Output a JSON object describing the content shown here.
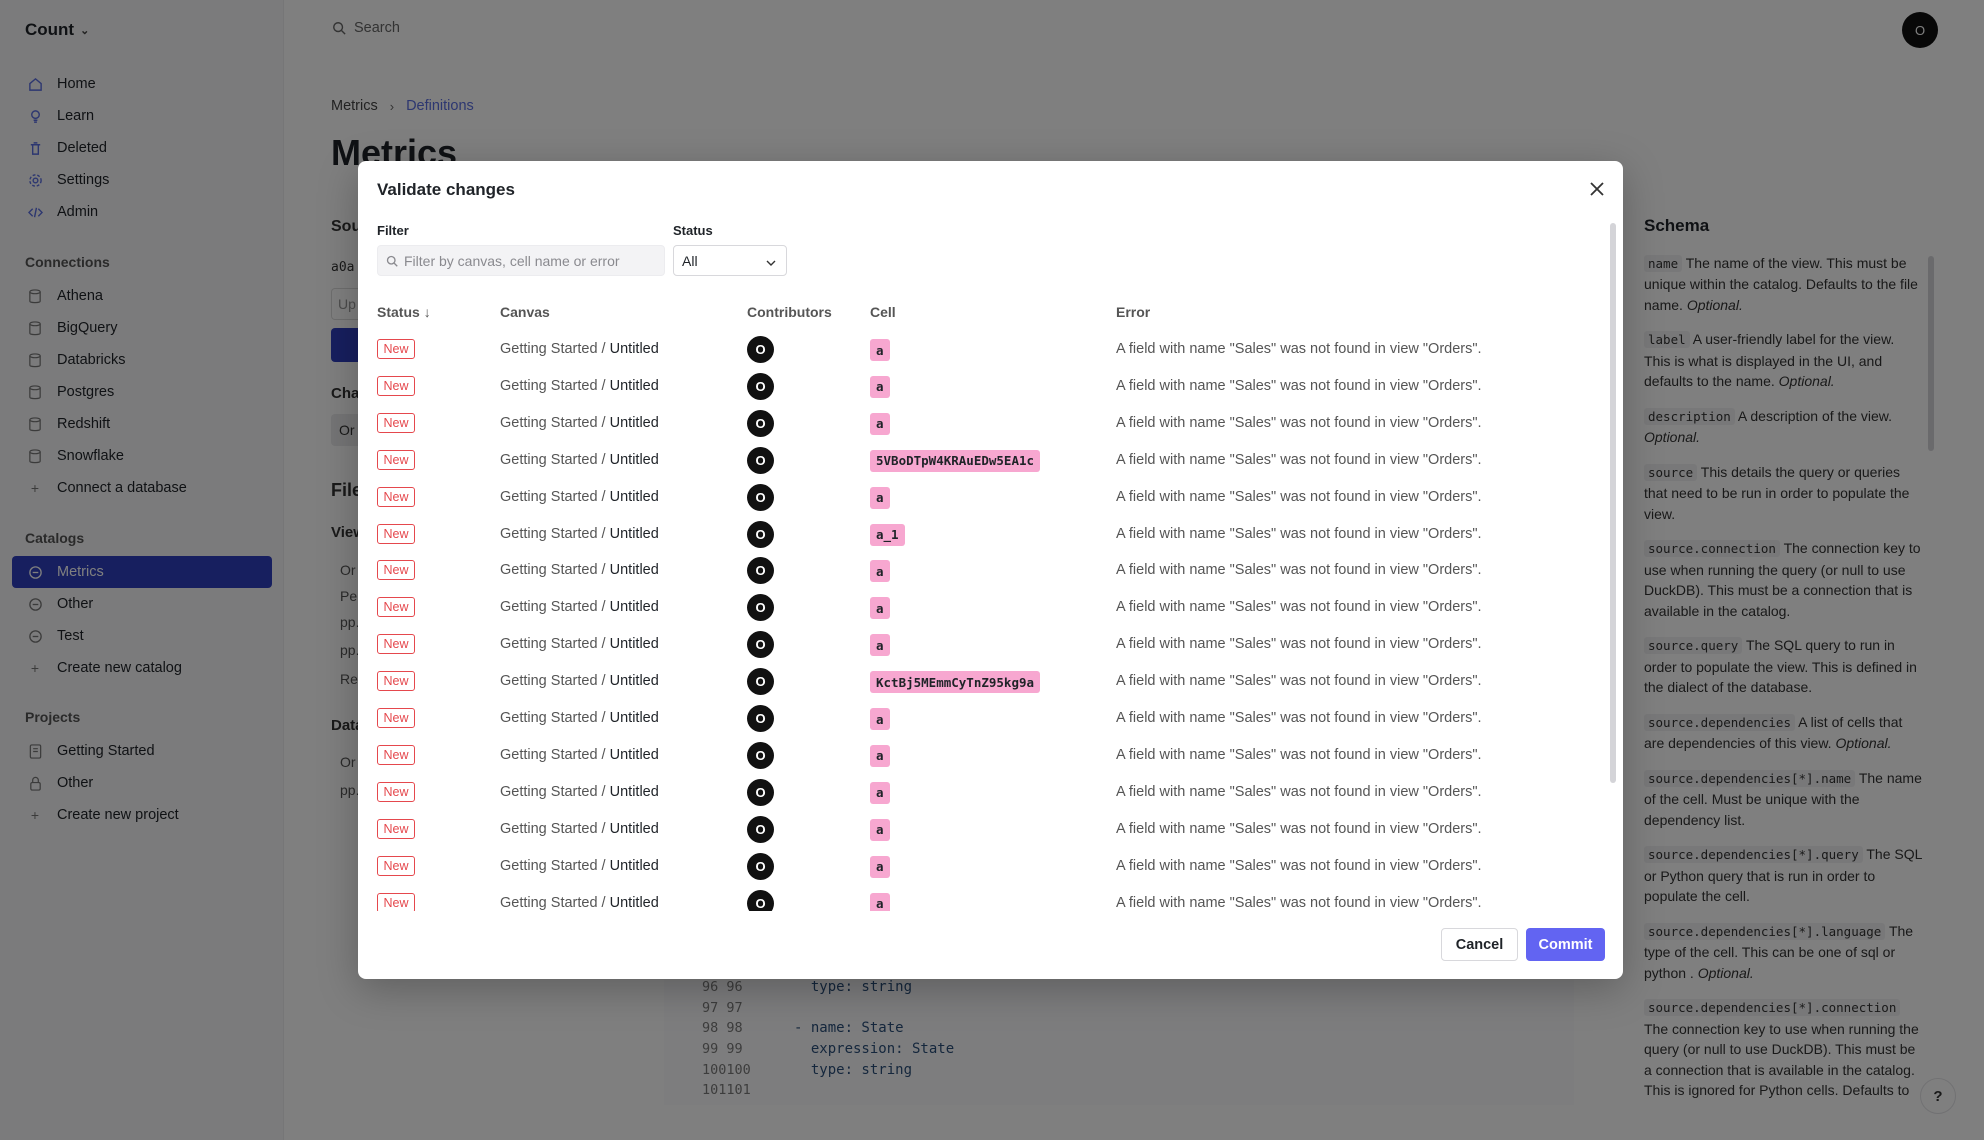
{
  "app": {
    "name": "Count"
  },
  "topbar": {
    "search_placeholder": "Search",
    "avatar_initial": "O"
  },
  "sidebar": {
    "nav": [
      {
        "label": "Home",
        "icon": "home-icon"
      },
      {
        "label": "Learn",
        "icon": "lightbulb-icon"
      },
      {
        "label": "Deleted",
        "icon": "trash-icon"
      },
      {
        "label": "Settings",
        "icon": "gear-icon"
      },
      {
        "label": "Admin",
        "icon": "code-icon"
      }
    ],
    "connections_label": "Connections",
    "connections": [
      {
        "label": "Athena"
      },
      {
        "label": "BigQuery"
      },
      {
        "label": "Databricks"
      },
      {
        "label": "Postgres"
      },
      {
        "label": "Redshift"
      },
      {
        "label": "Snowflake"
      },
      {
        "label": "Connect a database"
      }
    ],
    "catalogs_label": "Catalogs",
    "catalogs": [
      {
        "label": "Metrics",
        "active": true
      },
      {
        "label": "Other"
      },
      {
        "label": "Test"
      },
      {
        "label": "Create new catalog"
      }
    ],
    "projects_label": "Projects",
    "projects": [
      {
        "label": "Getting Started"
      },
      {
        "label": "Other"
      },
      {
        "label": "Create new project"
      }
    ]
  },
  "main": {
    "breadcrumb": [
      "Metrics",
      "Definitions"
    ],
    "title": "Metrics",
    "fragments": {
      "sou": "Sou",
      "a0a": "a0a",
      "up": "Up",
      "cha": "Cha",
      "or": "Or",
      "file": "File",
      "view": "View",
      "or2": "Or",
      "pe": "Pe",
      "pp1": "pp.",
      "pp2": "pp.",
      "re": "Re",
      "data": "Data",
      "or3": "Or",
      "pp3": "pp."
    }
  },
  "code": {
    "lines": [
      {
        "ln": "96  96",
        "text": "  type: string"
      },
      {
        "ln": "97  97",
        "text": ""
      },
      {
        "ln": "98  98",
        "text": "- name: State"
      },
      {
        "ln": "99  99",
        "text": "  expression: State"
      },
      {
        "ln": "100100",
        "text": "  type: string"
      },
      {
        "ln": "101101",
        "text": ""
      }
    ]
  },
  "schema": {
    "title": "Schema",
    "entries": [
      {
        "key": "name",
        "text": "The name of the view. This must be unique within the catalog. Defaults to the file name.",
        "note": "Optional."
      },
      {
        "key": "label",
        "text": "A user-friendly label for the view. This is what is displayed in the UI, and defaults to the name.",
        "note": "Optional."
      },
      {
        "key": "description",
        "text": "A description of the view.",
        "note": "Optional."
      },
      {
        "key": "source",
        "text": "This details the query or queries that need to be run in order to populate the view.",
        "note": ""
      },
      {
        "key": "source.connection",
        "text": "The connection key to use when running the query (or null to use DuckDB). This must be a connection that is available in the catalog.",
        "note": ""
      },
      {
        "key": "source.query",
        "text": "The SQL query to run in order to populate the view. This is defined in the dialect of the database.",
        "note": ""
      },
      {
        "key": "source.dependencies",
        "text": "A list of cells that are dependencies of this view.",
        "note": "Optional."
      },
      {
        "key": "source.dependencies[*].name",
        "text": "The name of the cell. Must be unique with the dependency list.",
        "note": ""
      },
      {
        "key": "source.dependencies[*].query",
        "text": "The SQL or Python query that is run in order to populate the cell.",
        "note": ""
      },
      {
        "key": "source.dependencies[*].language",
        "text": "The type of the cell. This can be one of sql or python .",
        "note": "Optional."
      },
      {
        "key": "source.dependencies[*].connection",
        "text": "The connection key to use when running the query (or null to use DuckDB). This must be a connection that is available in the catalog. This is ignored for Python cells. Defaults to the connection of the",
        "note": ""
      }
    ],
    "help": "?"
  },
  "modal": {
    "title": "Validate changes",
    "filter_label": "Filter",
    "filter_placeholder": "Filter by canvas, cell name or error",
    "status_label": "Status",
    "status_value": "All",
    "columns": {
      "status": "Status",
      "sort_arrow": "↓",
      "canvas": "Canvas",
      "contributors": "Contributors",
      "cell": "Cell",
      "error": "Error"
    },
    "rows": [
      {
        "status": "New",
        "project": "Getting Started",
        "canvas": "Untitled",
        "contributor": "O",
        "cell": "a",
        "error": "A field with name \"Sales\" was not found in view \"Orders\"."
      },
      {
        "status": "New",
        "project": "Getting Started",
        "canvas": "Untitled",
        "contributor": "O",
        "cell": "a",
        "error": "A field with name \"Sales\" was not found in view \"Orders\"."
      },
      {
        "status": "New",
        "project": "Getting Started",
        "canvas": "Untitled",
        "contributor": "O",
        "cell": "a",
        "error": "A field with name \"Sales\" was not found in view \"Orders\"."
      },
      {
        "status": "New",
        "project": "Getting Started",
        "canvas": "Untitled",
        "contributor": "O",
        "cell": "5VBoDTpW4KRAuEDw5EA1c",
        "error": "A field with name \"Sales\" was not found in view \"Orders\"."
      },
      {
        "status": "New",
        "project": "Getting Started",
        "canvas": "Untitled",
        "contributor": "O",
        "cell": "a",
        "error": "A field with name \"Sales\" was not found in view \"Orders\"."
      },
      {
        "status": "New",
        "project": "Getting Started",
        "canvas": "Untitled",
        "contributor": "O",
        "cell": "a_1",
        "error": "A field with name \"Sales\" was not found in view \"Orders\"."
      },
      {
        "status": "New",
        "project": "Getting Started",
        "canvas": "Untitled",
        "contributor": "O",
        "cell": "a",
        "error": "A field with name \"Sales\" was not found in view \"Orders\"."
      },
      {
        "status": "New",
        "project": "Getting Started",
        "canvas": "Untitled",
        "contributor": "O",
        "cell": "a",
        "error": "A field with name \"Sales\" was not found in view \"Orders\"."
      },
      {
        "status": "New",
        "project": "Getting Started",
        "canvas": "Untitled",
        "contributor": "O",
        "cell": "a",
        "error": "A field with name \"Sales\" was not found in view \"Orders\"."
      },
      {
        "status": "New",
        "project": "Getting Started",
        "canvas": "Untitled",
        "contributor": "O",
        "cell": "KctBj5MEmmCyTnZ95kg9a",
        "error": "A field with name \"Sales\" was not found in view \"Orders\"."
      },
      {
        "status": "New",
        "project": "Getting Started",
        "canvas": "Untitled",
        "contributor": "O",
        "cell": "a",
        "error": "A field with name \"Sales\" was not found in view \"Orders\"."
      },
      {
        "status": "New",
        "project": "Getting Started",
        "canvas": "Untitled",
        "contributor": "O",
        "cell": "a",
        "error": "A field with name \"Sales\" was not found in view \"Orders\"."
      },
      {
        "status": "New",
        "project": "Getting Started",
        "canvas": "Untitled",
        "contributor": "O",
        "cell": "a",
        "error": "A field with name \"Sales\" was not found in view \"Orders\"."
      },
      {
        "status": "New",
        "project": "Getting Started",
        "canvas": "Untitled",
        "contributor": "O",
        "cell": "a",
        "error": "A field with name \"Sales\" was not found in view \"Orders\"."
      },
      {
        "status": "New",
        "project": "Getting Started",
        "canvas": "Untitled",
        "contributor": "O",
        "cell": "a",
        "error": "A field with name \"Sales\" was not found in view \"Orders\"."
      },
      {
        "status": "New",
        "project": "Getting Started",
        "canvas": "Untitled",
        "contributor": "O",
        "cell": "a",
        "error": "A field with name \"Sales\" was not found in view \"Orders\"."
      }
    ],
    "cancel_label": "Cancel",
    "commit_label": "Commit"
  },
  "colors": {
    "accent": "#6264f2",
    "active_nav": "#2e3fbf",
    "new_badge": "#e5484d",
    "cell_chip": "#f7a7d0"
  }
}
